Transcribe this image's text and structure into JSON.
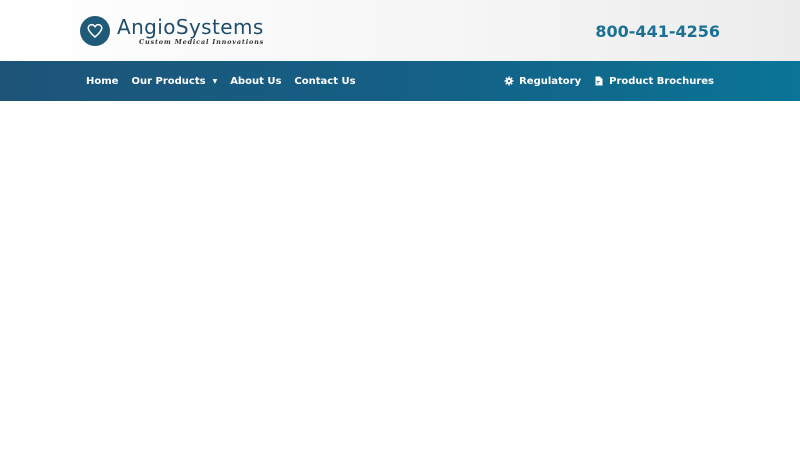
{
  "brand": {
    "name": "AngioSystems",
    "tagline": "Custom Medical Innovations",
    "logo_icon": "heart-icon",
    "color": "#1f5a78"
  },
  "header": {
    "phone": "800-441-4256",
    "phone_color": "#1a7194"
  },
  "nav": {
    "left": [
      {
        "label": "Home"
      },
      {
        "label": "Our Products",
        "has_dropdown": true,
        "dropdown_icon": "caret-down-icon"
      },
      {
        "label": "About Us"
      },
      {
        "label": "Contact Us"
      }
    ],
    "right": [
      {
        "label": "Regulatory",
        "icon": "gear-icon"
      },
      {
        "label": "Product Brochures",
        "icon": "document-icon"
      }
    ],
    "gradient": [
      "#1d5478",
      "#0a7596"
    ]
  }
}
